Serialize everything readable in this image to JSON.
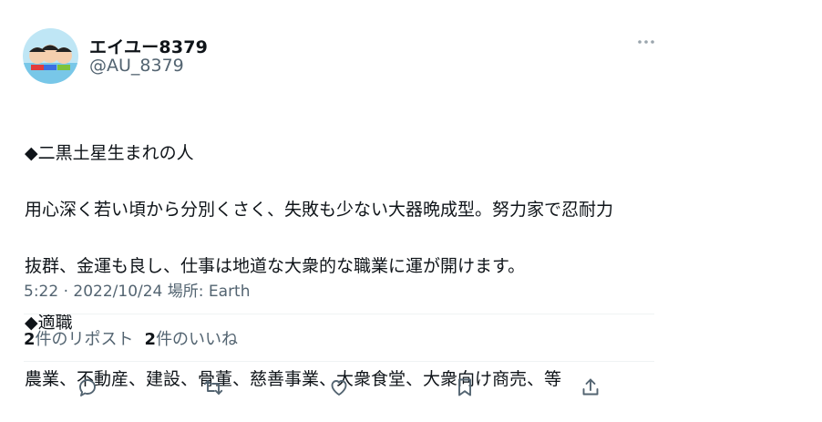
{
  "user": {
    "display_name": "エイユー8379",
    "handle": "@AU_8379"
  },
  "tweet": {
    "lines": [
      "◆二黒土星生まれの人",
      "用心深く若い頃から分別くさく、失敗も少ない大器晩成型。努力家で忍耐力",
      "抜群、金運も良し、仕事は地道な大衆的な職業に運が開けます。",
      "◆適職",
      "農業、不動産、建設、骨董、慈善事業、大衆食堂、大衆向け商売、等"
    ],
    "meta": "5:22 · 2022/10/24 場所: Earth"
  },
  "stats": {
    "reposts_count": "2",
    "reposts_label": "件のリポスト",
    "likes_count": "2",
    "likes_label": "件のいいね"
  },
  "icons": [
    "more-icon",
    "reply-icon",
    "retweet-icon",
    "like-icon",
    "bookmark-icon",
    "share-icon"
  ],
  "colors": {
    "text": "#0f1419",
    "secondary": "#536471",
    "divider": "#eff3f4"
  }
}
